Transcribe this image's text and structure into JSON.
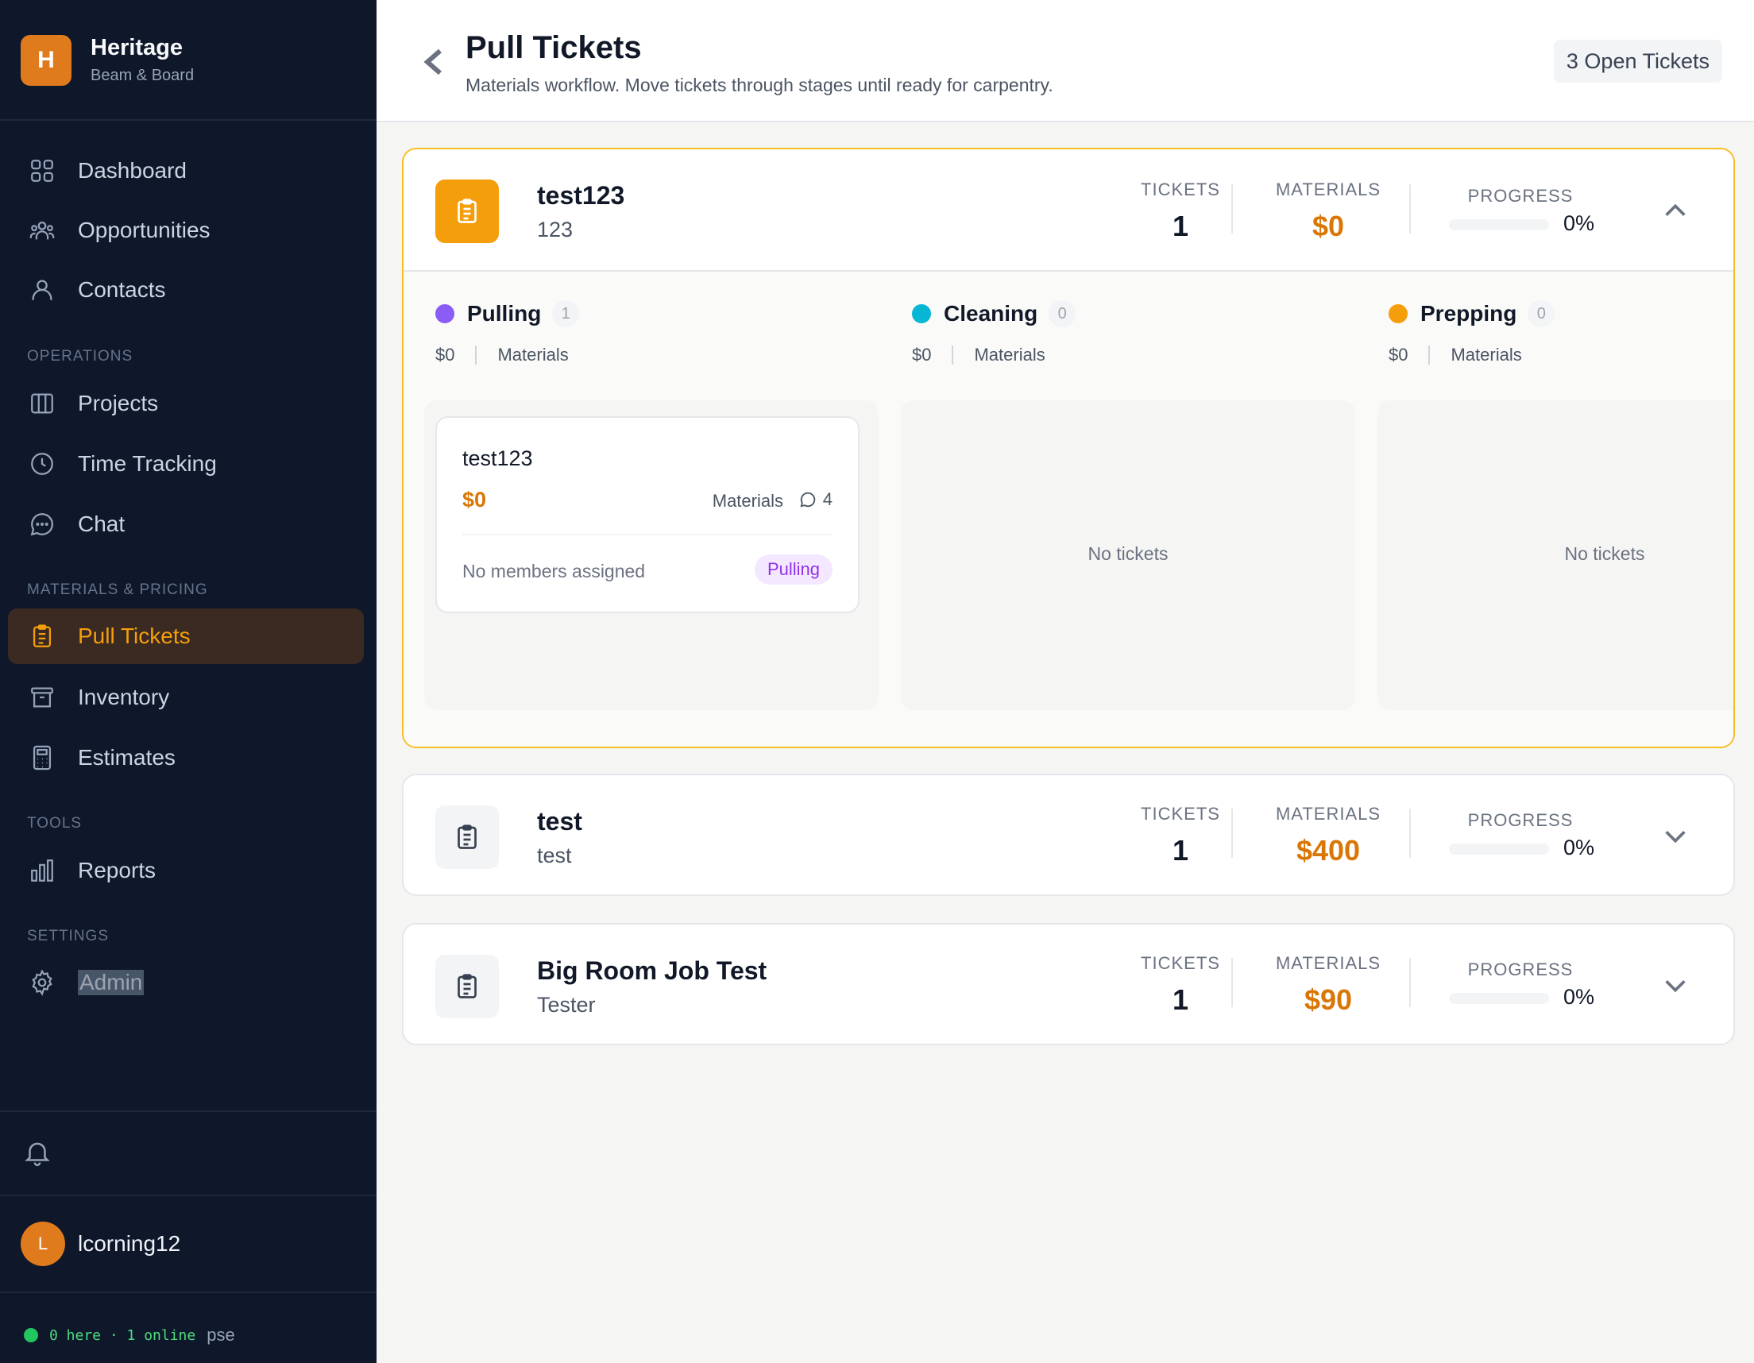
{
  "brand": {
    "initial": "H",
    "name": "Heritage",
    "subtitle": "Beam & Board"
  },
  "nav": {
    "dashboard": "Dashboard",
    "opportunities": "Opportunities",
    "contacts": "Contacts",
    "section_operations": "OPERATIONS",
    "projects": "Projects",
    "time_tracking": "Time Tracking",
    "chat": "Chat",
    "section_materials": "MATERIALS & PRICING",
    "pull_tickets": "Pull Tickets",
    "inventory": "Inventory",
    "estimates": "Estimates",
    "section_tools": "TOOLS",
    "reports": "Reports",
    "section_settings": "SETTINGS",
    "admin": "Admin"
  },
  "user": {
    "initial": "L",
    "name": "lcorning12"
  },
  "presence": {
    "text": "0 here · 1 online",
    "extra": "pse"
  },
  "header": {
    "title": "Pull Tickets",
    "subtitle": "Materials workflow. Move tickets through stages until ready for carpentry.",
    "open_badge": "3 Open Tickets"
  },
  "stat_labels": {
    "tickets": "TICKETS",
    "materials": "MATERIALS",
    "progress": "PROGRESS"
  },
  "projects": [
    {
      "name": "test123",
      "subtitle": "123",
      "tickets": "1",
      "materials": "$0",
      "progress_pct": "0%",
      "progress": 0,
      "expanded": true
    },
    {
      "name": "test",
      "subtitle": "test",
      "tickets": "1",
      "materials": "$400",
      "progress_pct": "0%",
      "progress": 0,
      "expanded": false
    },
    {
      "name": "Big Room Job Test",
      "subtitle": "Tester",
      "tickets": "1",
      "materials": "$90",
      "progress_pct": "0%",
      "progress": 0,
      "expanded": false
    }
  ],
  "columns": [
    {
      "name": "Pulling",
      "count": "1",
      "color": "#8b5cf6",
      "amount": "$0",
      "materials_label": "Materials",
      "empty": ""
    },
    {
      "name": "Cleaning",
      "count": "0",
      "color": "#06b6d4",
      "amount": "$0",
      "materials_label": "Materials",
      "empty": "No tickets"
    },
    {
      "name": "Prepping",
      "count": "0",
      "color": "#f59e0b",
      "amount": "$0",
      "materials_label": "Materials",
      "empty": "No tickets"
    }
  ],
  "ticket": {
    "name": "test123",
    "amount": "$0",
    "materials_label": "Materials",
    "comments": "4",
    "members": "No members assigned",
    "stage": "Pulling"
  },
  "colors": {
    "sidebar_bg": "#0f172a",
    "accent": "#f59e0b",
    "money": "#d97706"
  }
}
